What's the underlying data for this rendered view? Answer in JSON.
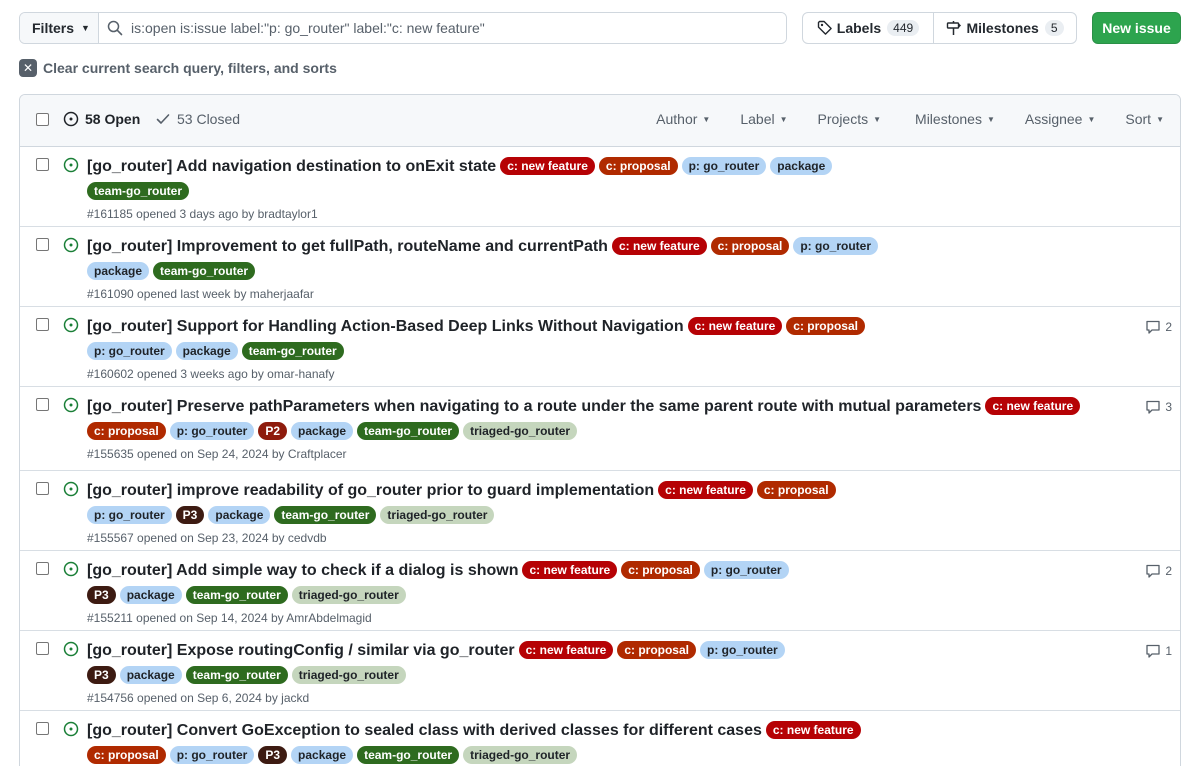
{
  "toolbar": {
    "filters_label": "Filters",
    "search_value": "is:open is:issue label:\"p: go_router\" label:\"c: new feature\"",
    "labels_label": "Labels",
    "labels_count": "449",
    "milestones_label": "Milestones",
    "milestones_count": "5",
    "new_issue_label": "New issue"
  },
  "clear_text": "Clear current search query, filters, and sorts",
  "header": {
    "open_label": "58 Open",
    "closed_label": "53 Closed",
    "filters": [
      "Author",
      "Label",
      "Projects",
      "Milestones",
      "Assignee",
      "Sort"
    ]
  },
  "label_colors": {
    "c: new feature": {
      "bg": "#b60205",
      "fg": "#ffffff"
    },
    "c: proposal": {
      "bg": "#b02a00",
      "fg": "#ffffff"
    },
    "p: go_router": {
      "bg": "#b3d4f5",
      "fg": "#1f2328"
    },
    "package": {
      "bg": "#b3d4f5",
      "fg": "#1f2328"
    },
    "team-go_router": {
      "bg": "#2e6b1f",
      "fg": "#ffffff"
    },
    "triaged-go_router": {
      "bg": "#c5d6bd",
      "fg": "#1f2328"
    },
    "P2": {
      "bg": "#8e1b0c",
      "fg": "#ffffff"
    },
    "P3": {
      "bg": "#3d1b12",
      "fg": "#ffffff"
    }
  },
  "issues": [
    {
      "title": "[go_router] Add navigation destination to onExit state",
      "labels": [
        "c: new feature",
        "c: proposal",
        "p: go_router",
        "package",
        "team-go_router"
      ],
      "meta": "#161185 opened 3 days ago by bradtaylor1",
      "comments": ""
    },
    {
      "title": "[go_router] Improvement to get fullPath, routeName and currentPath",
      "labels": [
        "c: new feature",
        "c: proposal",
        "p: go_router",
        "package",
        "team-go_router"
      ],
      "meta": "#161090 opened last week by maherjaafar",
      "comments": ""
    },
    {
      "title": "[go_router] Support for Handling Action-Based Deep Links Without Navigation",
      "labels": [
        "c: new feature",
        "c: proposal",
        "p: go_router",
        "package",
        "team-go_router"
      ],
      "meta": "#160602 opened 3 weeks ago by omar-hanafy",
      "comments": "2"
    },
    {
      "title": "[go_router] Preserve pathParameters when navigating to a route under the same parent route with mutual parameters",
      "labels": [
        "c: new feature",
        "c: proposal",
        "p: go_router",
        "P2",
        "package",
        "team-go_router",
        "triaged-go_router"
      ],
      "meta": "#155635 opened on Sep 24, 2024 by Craftplacer",
      "comments": "3"
    },
    {
      "title": "[go_router] improve readability of go_router prior to guard implementation",
      "labels": [
        "c: new feature",
        "c: proposal",
        "p: go_router",
        "P3",
        "package",
        "team-go_router",
        "triaged-go_router"
      ],
      "meta": "#155567 opened on Sep 23, 2024 by cedvdb",
      "comments": ""
    },
    {
      "title": "[go_router] Add simple way to check if a dialog is shown",
      "labels": [
        "c: new feature",
        "c: proposal",
        "p: go_router",
        "P3",
        "package",
        "team-go_router",
        "triaged-go_router"
      ],
      "meta": "#155211 opened on Sep 14, 2024 by AmrAbdelmagid",
      "comments": "2"
    },
    {
      "title": "[go_router] Expose routingConfig / similar via go_router",
      "labels": [
        "c: new feature",
        "c: proposal",
        "p: go_router",
        "P3",
        "package",
        "team-go_router",
        "triaged-go_router"
      ],
      "meta": "#154756 opened on Sep 6, 2024 by jackd",
      "comments": "1"
    },
    {
      "title": "[go_router] Convert GoException to sealed class with derived classes for different cases",
      "labels": [
        "c: new feature",
        "c: proposal",
        "p: go_router",
        "P3",
        "package",
        "team-go_router",
        "triaged-go_router"
      ],
      "meta": "",
      "comments": ""
    }
  ]
}
